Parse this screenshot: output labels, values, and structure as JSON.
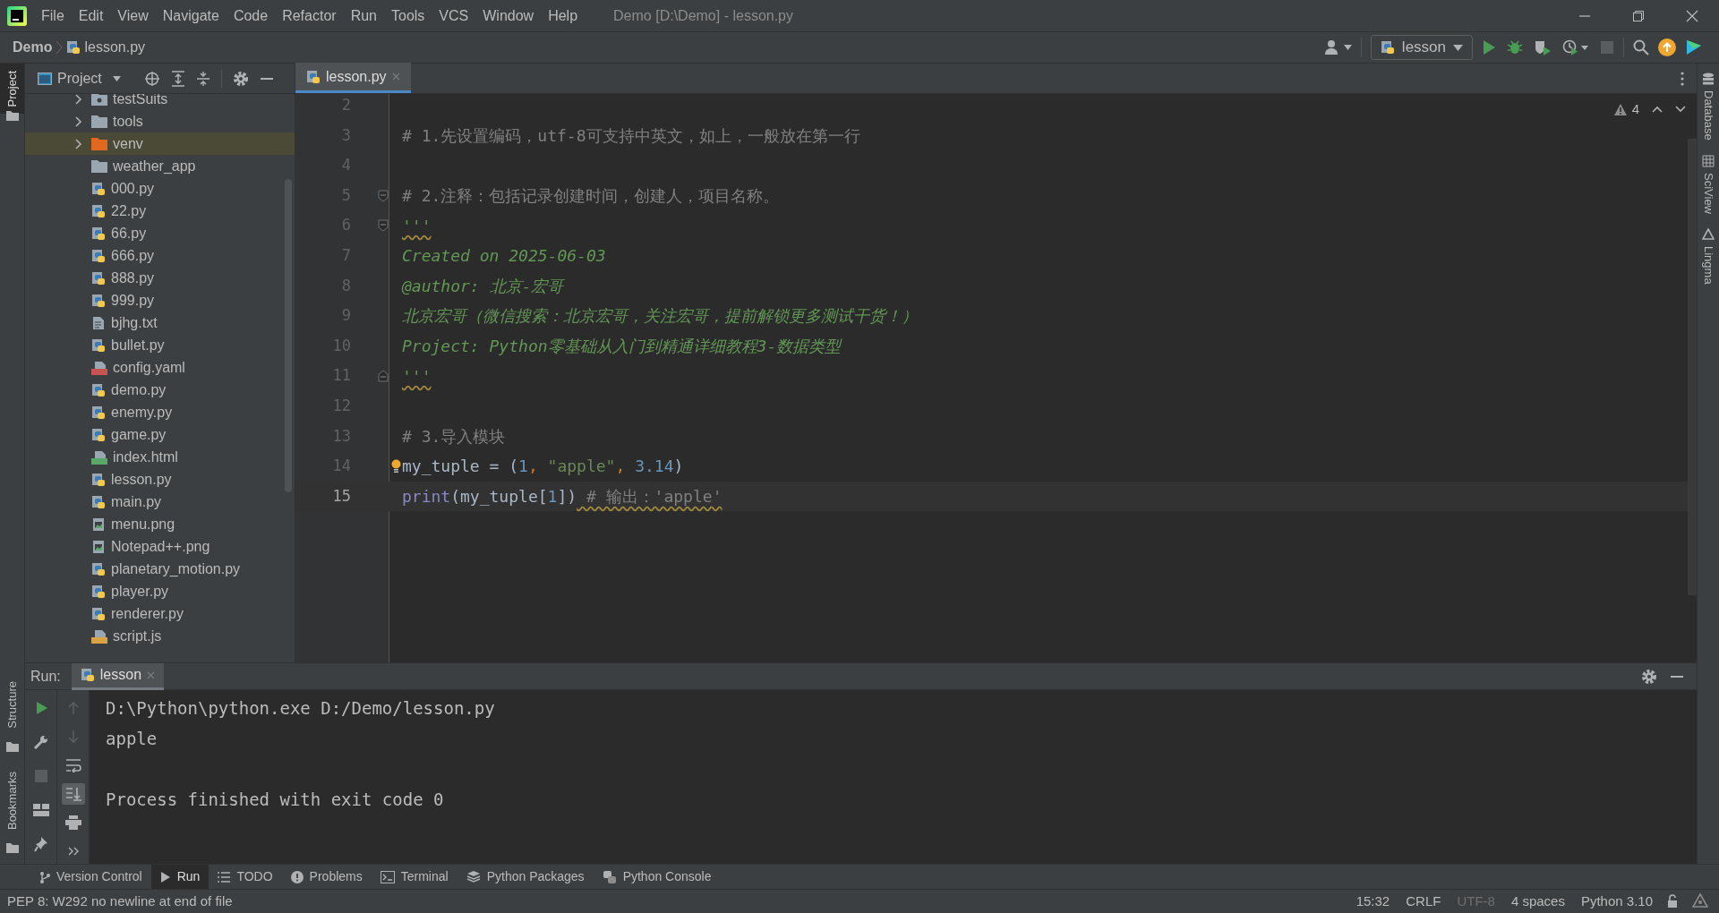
{
  "window": {
    "title": "Demo [D:\\Demo] - lesson.py"
  },
  "menu": [
    "File",
    "Edit",
    "View",
    "Navigate",
    "Code",
    "Refactor",
    "Run",
    "Tools",
    "VCS",
    "Window",
    "Help"
  ],
  "breadcrumb": [
    {
      "label": "Demo",
      "kind": "project"
    },
    {
      "label": "lesson.py",
      "kind": "python"
    }
  ],
  "toolbar": {
    "run_config": "lesson",
    "buttons": [
      {
        "kind": "run",
        "disabled": false
      },
      {
        "kind": "debug",
        "disabled": false
      },
      {
        "kind": "coverage",
        "disabled": false
      },
      {
        "kind": "profile",
        "disabled": false
      },
      {
        "kind": "stop",
        "disabled": true
      }
    ]
  },
  "left_stripe_top": [
    {
      "label": "Project",
      "selected": true
    }
  ],
  "left_stripe_bottom": [
    {
      "label": "Structure",
      "selected": false
    },
    {
      "label": "Bookmarks",
      "selected": false
    }
  ],
  "right_stripe": [
    {
      "label": "Database",
      "kind": "database"
    },
    {
      "label": "SciView",
      "kind": "sciview"
    },
    {
      "label": "Lingma",
      "kind": "lingma"
    }
  ],
  "project_panel": {
    "title": "Project",
    "items": [
      {
        "label": "testSuits",
        "kind": "package",
        "expanded": false,
        "selected": false
      },
      {
        "label": "tools",
        "kind": "folder",
        "expanded": false,
        "selected": false
      },
      {
        "label": "venv",
        "kind": "excluded",
        "expanded": false,
        "selected": true
      },
      {
        "label": "weather_app",
        "kind": "folder",
        "selected": false
      },
      {
        "label": "000.py",
        "kind": "python",
        "selected": false
      },
      {
        "label": "22.py",
        "kind": "python",
        "selected": false
      },
      {
        "label": "66.py",
        "kind": "python",
        "selected": false
      },
      {
        "label": "666.py",
        "kind": "python",
        "selected": false
      },
      {
        "label": "888.py",
        "kind": "python",
        "selected": false
      },
      {
        "label": "999.py",
        "kind": "python",
        "selected": false
      },
      {
        "label": "bjhg.txt",
        "kind": "text",
        "selected": false
      },
      {
        "label": "bullet.py",
        "kind": "python",
        "selected": false
      },
      {
        "label": "config.yaml",
        "kind": "yaml",
        "selected": false
      },
      {
        "label": "demo.py",
        "kind": "python",
        "selected": false
      },
      {
        "label": "enemy.py",
        "kind": "python",
        "selected": false
      },
      {
        "label": "game.py",
        "kind": "python",
        "selected": false
      },
      {
        "label": "index.html",
        "kind": "html",
        "selected": false
      },
      {
        "label": "lesson.py",
        "kind": "python",
        "selected": false
      },
      {
        "label": "main.py",
        "kind": "python",
        "selected": false
      },
      {
        "label": "menu.png",
        "kind": "image",
        "selected": false
      },
      {
        "label": "Notepad++.png",
        "kind": "image",
        "selected": false
      },
      {
        "label": "planetary_motion.py",
        "kind": "python",
        "selected": false
      },
      {
        "label": "player.py",
        "kind": "python",
        "selected": false
      },
      {
        "label": "renderer.py",
        "kind": "python",
        "selected": false
      },
      {
        "label": "script.js",
        "kind": "js",
        "selected": false
      }
    ]
  },
  "editor": {
    "tabs": [
      {
        "label": "lesson.py",
        "selected": true
      }
    ],
    "warnings": "4",
    "lines": [
      {
        "number": "2",
        "current": false
      },
      {
        "number": "3",
        "current": false,
        "tokens": [
          {
            "text": "# 1.先设置编码，utf-8可支持中英文，如上，一般放在第一行",
            "kind": "comment"
          }
        ]
      },
      {
        "number": "4",
        "current": false
      },
      {
        "number": "5",
        "current": false,
        "fold_start": true,
        "tokens": [
          {
            "text": "# 2.注释：包括记录创建时间，创建人，项目名称。",
            "kind": "comment"
          }
        ]
      },
      {
        "number": "6",
        "current": false,
        "fold_start": true,
        "tokens": [
          {
            "text": "'''",
            "kind": "doc",
            "warning": true
          }
        ]
      },
      {
        "number": "7",
        "current": false,
        "tokens": [
          {
            "text": "Created on 2025-06-03",
            "kind": "doc"
          }
        ]
      },
      {
        "number": "8",
        "current": false,
        "tokens": [
          {
            "text": "@author: 北京-宏哥",
            "kind": "doc"
          }
        ]
      },
      {
        "number": "9",
        "current": false,
        "tokens": [
          {
            "text": "北京宏哥（微信搜索：北京宏哥，关注宏哥，提前解锁更多测试干货！）",
            "kind": "doc"
          }
        ]
      },
      {
        "number": "10",
        "current": false,
        "tokens": [
          {
            "text": "Project: Python零基础从入门到精通详细教程3-数据类型",
            "kind": "doc"
          }
        ]
      },
      {
        "number": "11",
        "current": false,
        "fold_end": true,
        "tokens": [
          {
            "text": "'''",
            "kind": "doc",
            "warning": true
          }
        ]
      },
      {
        "number": "12",
        "current": false
      },
      {
        "number": "13",
        "current": false,
        "tokens": [
          {
            "text": "# 3.导入模块",
            "kind": "comment"
          }
        ]
      },
      {
        "number": "14",
        "current": false,
        "bulb": true,
        "tokens": [
          {
            "text": "my_tuple = (",
            "kind": "plain"
          },
          {
            "text": "1",
            "kind": "number"
          },
          {
            "text": ", ",
            "kind": "keyword"
          },
          {
            "text": "\"apple\"",
            "kind": "string"
          },
          {
            "text": ", ",
            "kind": "keyword"
          },
          {
            "text": "3.14",
            "kind": "number"
          },
          {
            "text": ")",
            "kind": "plain"
          }
        ]
      },
      {
        "number": "15",
        "current": true,
        "tokens": [
          {
            "text": "print",
            "kind": "builtin"
          },
          {
            "text": "(my_tuple[",
            "kind": "plain"
          },
          {
            "text": "1",
            "kind": "number"
          },
          {
            "text": "])",
            "kind": "plain"
          },
          {
            "text": " # 输出：'apple'",
            "kind": "comment",
            "warning": true
          }
        ]
      }
    ]
  },
  "run_panel": {
    "title": "Run:",
    "tabs": [
      {
        "label": "lesson",
        "selected": true
      }
    ],
    "tools_left": [
      {
        "kind": "rerun",
        "disabled": false
      },
      {
        "kind": "wrench",
        "disabled": false
      },
      {
        "kind": "stop",
        "disabled": true
      },
      {
        "kind": "layout",
        "disabled": false
      },
      {
        "kind": "pin",
        "disabled": false
      }
    ],
    "tools_right": [
      {
        "kind": "up",
        "disabled": true,
        "selected": false
      },
      {
        "kind": "down",
        "disabled": true,
        "selected": false
      },
      {
        "kind": "wrap",
        "disabled": false,
        "selected": false
      },
      {
        "kind": "scroll",
        "disabled": false,
        "selected": true
      },
      {
        "kind": "print",
        "disabled": false,
        "selected": false
      },
      {
        "kind": "more",
        "disabled": false,
        "selected": false
      }
    ],
    "output": {
      "lines": [
        "D:\\Python\\python.exe D:/Demo/lesson.py",
        "apple"
      ],
      "exit_message": "Process finished with exit code 0"
    }
  },
  "tool_windows": [
    {
      "label": "Version Control",
      "kind": "vcs",
      "selected": false
    },
    {
      "label": "Run",
      "kind": "run",
      "selected": true
    },
    {
      "label": "TODO",
      "kind": "todo",
      "selected": false
    },
    {
      "label": "Problems",
      "kind": "problems",
      "selected": false
    },
    {
      "label": "Terminal",
      "kind": "terminal",
      "selected": false
    },
    {
      "label": "Python Packages",
      "kind": "packages",
      "selected": false
    },
    {
      "label": "Python Console",
      "kind": "console",
      "selected": false
    }
  ],
  "status_bar": {
    "message": "PEP 8: W292 no newline at end of file",
    "items": [
      {
        "label": "15:32",
        "disabled": false
      },
      {
        "label": "CRLF",
        "disabled": false
      },
      {
        "label": "UTF-8",
        "disabled": true
      },
      {
        "label": "4 spaces",
        "disabled": false
      },
      {
        "label": "Python 3.10",
        "disabled": false
      }
    ]
  }
}
